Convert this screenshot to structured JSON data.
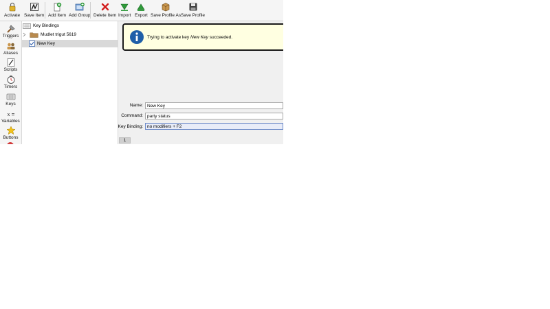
{
  "toolbar": {
    "activate": "Activate",
    "save_item": "Save Item",
    "add_item": "Add Item",
    "add_group": "Add Group",
    "delete_item": "Delete Item",
    "import": "Import",
    "export": "Export",
    "save_profile_as": "Save Profile As",
    "save_profile": "Save Profile"
  },
  "sidebar": {
    "items": [
      {
        "label": "Triggers",
        "icon": "triggers-icon"
      },
      {
        "label": "Aliases",
        "icon": "aliases-icon"
      },
      {
        "label": "Scripts",
        "icon": "scripts-icon"
      },
      {
        "label": "Timers",
        "icon": "timers-icon"
      },
      {
        "label": "Keys",
        "icon": "keys-icon"
      },
      {
        "label": "Variables",
        "icon": "variables-icon"
      },
      {
        "label": "Buttons",
        "icon": "buttons-icon"
      }
    ]
  },
  "tree": {
    "root": "Key Bindings",
    "folder": "Mudlet trigut 5619",
    "selected_item": "New Key"
  },
  "banner": {
    "prefix": "Trying to activate key ",
    "item": "New Key",
    "suffix": " succeeded."
  },
  "form": {
    "name_label": "Name:",
    "name_value": "New Key",
    "command_label": "Command:",
    "command_value": "party status",
    "keybinding_label": "Key Binding:",
    "keybinding_value": "no modifiers + F2"
  },
  "bottom_tab": "1",
  "colors": {
    "banner_bg": "#ffffe1",
    "info_icon": "#1f5fa8",
    "selection": "#d9d9d9"
  }
}
